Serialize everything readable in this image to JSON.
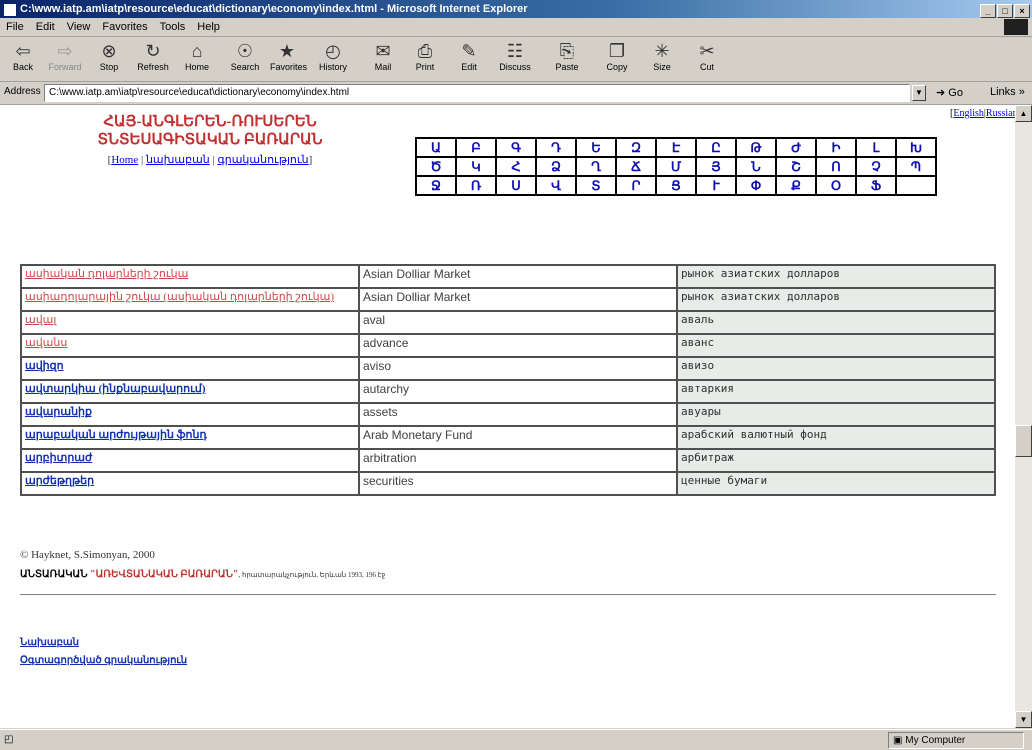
{
  "window": {
    "title": "C:\\www.iatp.am\\iatp\\resource\\educat\\dictionary\\economy\\index.html - Microsoft Internet Explorer",
    "controls": [
      "_",
      "□",
      "×"
    ]
  },
  "menu": [
    "File",
    "Edit",
    "View",
    "Favorites",
    "Tools",
    "Help"
  ],
  "toolbar": [
    {
      "label": "Back",
      "icon": "back-arrow-icon",
      "glyph": "⇦",
      "enabled": true
    },
    {
      "label": "Forward",
      "icon": "forward-arrow-icon",
      "glyph": "⇨",
      "enabled": false
    },
    {
      "label": "Stop",
      "icon": "stop-icon",
      "glyph": "⊗",
      "enabled": true
    },
    {
      "label": "Refresh",
      "icon": "refresh-icon",
      "glyph": "↻",
      "enabled": true
    },
    {
      "label": "Home",
      "icon": "home-icon",
      "glyph": "⌂",
      "enabled": true
    },
    {
      "label": "Search",
      "icon": "search-icon",
      "glyph": "☉",
      "enabled": true
    },
    {
      "label": "Favorites",
      "icon": "favorites-icon",
      "glyph": "★",
      "enabled": true
    },
    {
      "label": "History",
      "icon": "history-icon",
      "glyph": "◴",
      "enabled": true
    },
    {
      "label": "Mail",
      "icon": "mail-icon",
      "glyph": "✉",
      "enabled": true
    },
    {
      "label": "Print",
      "icon": "print-icon",
      "glyph": "⎙",
      "enabled": true
    },
    {
      "label": "Edit",
      "icon": "edit-icon",
      "glyph": "✎",
      "enabled": true
    },
    {
      "label": "Discuss",
      "icon": "discuss-icon",
      "glyph": "☷",
      "enabled": true
    },
    {
      "label": "Paste",
      "icon": "paste-icon",
      "glyph": "⎘",
      "enabled": true
    },
    {
      "label": "Copy",
      "icon": "copy-icon",
      "glyph": "❐",
      "enabled": true
    },
    {
      "label": "Size",
      "icon": "size-icon",
      "glyph": "✳",
      "enabled": true
    },
    {
      "label": "Cut",
      "icon": "cut-icon",
      "glyph": "✂",
      "enabled": true
    }
  ],
  "address": {
    "label": "Address",
    "value": "C:\\www.iatp.am\\iatp\\resource\\educat\\dictionary\\economy\\index.html",
    "go": "Go",
    "links": "Links »"
  },
  "page": {
    "lang_links": [
      "English",
      "Russian"
    ],
    "title_line1": "ՀԱՅ-ԱՆԳԼԵՐԵՆ-ՌՈՒՍԵՐԵՆ",
    "title_line2": "ՏՆՏԵՍԱԳԻՏԱԿԱՆ ԲԱՌԱՐԱՆ",
    "nav": {
      "home": "Home",
      "intro": "նախաբան",
      "sources": "գրականություն"
    },
    "alphabet": [
      [
        "Ա",
        "Բ",
        "Գ",
        "Դ",
        "Ե",
        "Զ",
        "Է",
        "Ը",
        "Թ",
        "Ժ",
        "Ի",
        "Լ",
        "Խ"
      ],
      [
        "Ծ",
        "Կ",
        "Հ",
        "Ձ",
        "Ղ",
        "Ճ",
        "Մ",
        "Յ",
        "Ն",
        "Շ",
        "Ո",
        "Չ",
        "Պ"
      ],
      [
        "Ջ",
        "Ռ",
        "Ս",
        "Վ",
        "Տ",
        "Ր",
        "Ց",
        "Ւ",
        "Փ",
        "Ք",
        "Օ",
        "Ֆ",
        ""
      ]
    ],
    "entries": [
      {
        "arm": "ասիական դոլարների շուկա",
        "eng": "Asian Dolliar Market",
        "rus": "рынок азиатских долларов",
        "style": "red"
      },
      {
        "arm": "ասիադոլարային շուկա (ասիական դոլարների շուկա)",
        "eng": "Asian Dolliar Market",
        "rus": "рынок азиатских долларов",
        "style": "red"
      },
      {
        "arm": "ավալ",
        "eng": "aval",
        "rus": "аваль",
        "style": "red"
      },
      {
        "arm": "ավանս",
        "eng": "advance",
        "rus": "аванс",
        "style": "red"
      },
      {
        "arm": "ավիզո",
        "eng": "aviso",
        "rus": "авизо",
        "style": "blue"
      },
      {
        "arm": "ավտարկիա (ինքնաբավարում)",
        "eng": "autarchy",
        "rus": "автаркия",
        "style": "blue"
      },
      {
        "arm": "ավարանիք",
        "eng": "assets",
        "rus": "авуары",
        "style": "blue"
      },
      {
        "arm": "արաբական արժույթային ֆոնդ",
        "eng": "Arab Monetary Fund",
        "rus": "арабский валютный фонд",
        "style": "blue"
      },
      {
        "arm": "արբիտրաժ",
        "eng": "arbitration",
        "rus": "арбитраж",
        "style": "blue"
      },
      {
        "arm": "արժեթղթեր",
        "eng": "securities",
        "rus": "ценные бумаги",
        "style": "blue"
      }
    ],
    "copyright": "© Hayknet, S.Simonyan, 2000",
    "source_label": "ԱՆՏԱՌԱԿԱՆ",
    "source_book": "\"ԱՌԵՎՏԱՆԱԿԱՆ ԲԱՌԱՐԱՆ\"",
    "source_rest": ", հրատարակչություն, Երևան 1993, 196 էջ",
    "footer_links": [
      "Նախաբան",
      "Օգտագործված գրականություն"
    ]
  },
  "status": {
    "zone": "My Computer",
    "icon": "ie-page-icon"
  }
}
